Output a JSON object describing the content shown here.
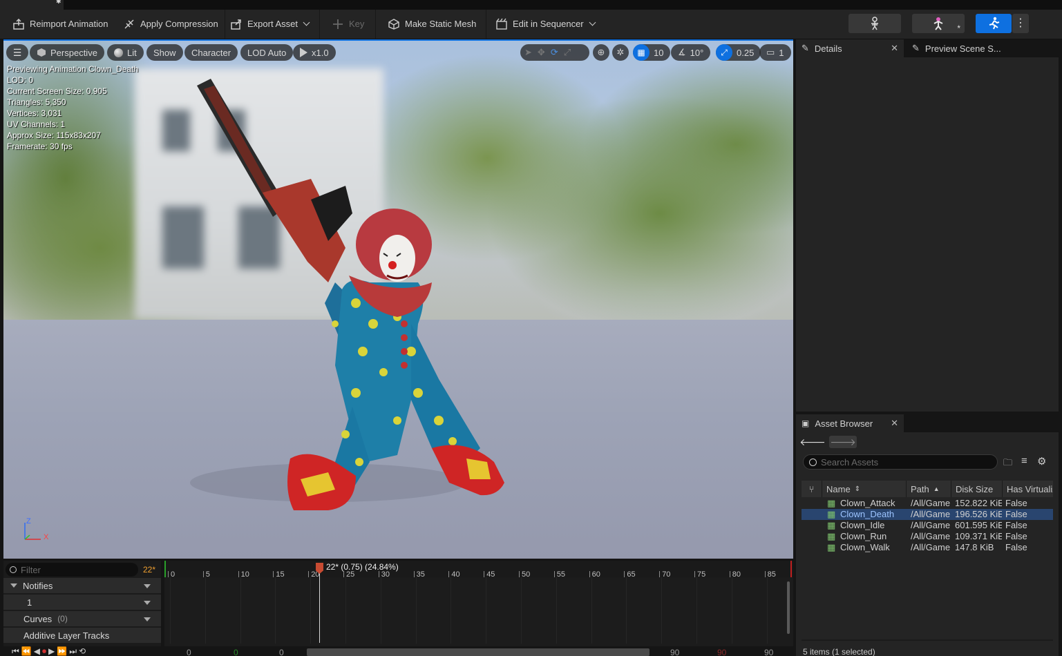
{
  "toolbar": {
    "reimport": "Reimport Animation",
    "apply_compression": "Apply Compression",
    "export_asset": "Export Asset",
    "key": "Key",
    "make_static_mesh": "Make Static Mesh",
    "edit_in_sequencer": "Edit in Sequencer"
  },
  "viewport": {
    "perspective": "Perspective",
    "lit": "Lit",
    "show": "Show",
    "character": "Character",
    "lod": "LOD Auto",
    "speed": "x1.0",
    "grid_snap": "10",
    "rotation_snap": "10°",
    "scale_snap": "0.25",
    "camera_speed": "1",
    "stats": [
      "Previewing Animation Clown_Death",
      "LOD: 0",
      "Current Screen Size: 0.905",
      "Triangles: 5,350",
      "Vertices: 3,031",
      "UV Channels: 1",
      "Approx Size: 115x83x207",
      "Framerate: 30 fps"
    ],
    "axis_z": "Z",
    "axis_x": "X"
  },
  "panels": {
    "details": "Details",
    "preview_scene": "Preview Scene S...",
    "asset_browser": "Asset Browser"
  },
  "asset_browser": {
    "search_placeholder": "Search Assets",
    "columns": [
      "Name",
      "Path",
      "Disk Size",
      "Has Virtualiz"
    ],
    "rows": [
      {
        "name": "Clown_Attack",
        "path": "/All/Game",
        "size": "152.822 KiE",
        "virt": "False"
      },
      {
        "name": "Clown_Death",
        "path": "/All/Game",
        "size": "196.526 KiE",
        "virt": "False"
      },
      {
        "name": "Clown_Idle",
        "path": "/All/Game",
        "size": "601.595 KiE",
        "virt": "False"
      },
      {
        "name": "Clown_Run",
        "path": "/All/Game",
        "size": "109.371 KiE",
        "virt": "False"
      },
      {
        "name": "Clown_Walk",
        "path": "/All/Game",
        "size": "147.8 KiB",
        "virt": "False"
      }
    ],
    "footer": "5 items (1 selected)"
  },
  "timeline": {
    "filter_placeholder": "Filter",
    "current_frame": "22*",
    "playhead_label": "22* (0.75) (24.84%)",
    "tracks": {
      "notifies": "Notifies",
      "notify_1": "1",
      "curves": "Curves",
      "curves_count": "(0)",
      "additive": "Additive Layer Tracks"
    },
    "ticks": [
      "0",
      "5",
      "10",
      "15",
      "20",
      "25",
      "30",
      "35",
      "40",
      "45",
      "50",
      "55",
      "60",
      "65",
      "70",
      "75",
      "80",
      "85"
    ],
    "transport_values": [
      "0",
      "0",
      "0",
      "90",
      "90",
      "90"
    ]
  },
  "colors": {
    "accent": "#0e70e0",
    "selected_row": "#29456f",
    "playhead": "#c84b32",
    "frame_text": "#f0a030"
  }
}
